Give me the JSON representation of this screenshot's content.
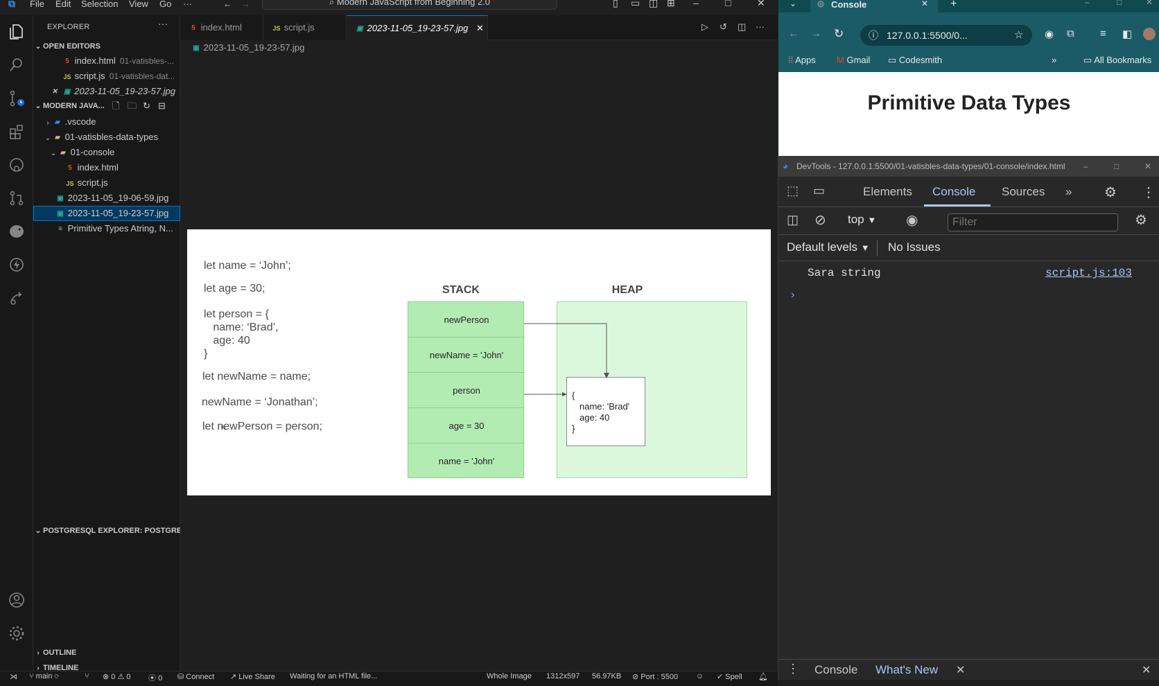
{
  "vscode": {
    "menu": [
      "File",
      "Edit",
      "Selection",
      "View",
      "Go",
      "···"
    ],
    "command_center": "Modern JavaScript from Beginning 2.0",
    "sidebar": {
      "title": "EXPLORER",
      "open_editors_title": "OPEN EDITORS",
      "open_editors": [
        {
          "name": "index.html",
          "desc": "01-vatisbles-...",
          "icon": "html-icon"
        },
        {
          "name": "script.js",
          "desc": "01-vatisbles-dat...",
          "icon": "js-icon"
        },
        {
          "name": "2023-11-05_19-23-57.jpg",
          "desc": "",
          "icon": "image-icon"
        }
      ],
      "workspace_title": "MODERN JAVA...",
      "tree": [
        {
          "name": ".vscode",
          "type": "folder",
          "level": 1
        },
        {
          "name": "01-vatisbles-data-types",
          "type": "folder-open",
          "level": 1
        },
        {
          "name": "01-console",
          "type": "folder-open",
          "level": 2
        },
        {
          "name": "index.html",
          "type": "html",
          "level": 3
        },
        {
          "name": "script.js",
          "type": "js",
          "level": 3
        },
        {
          "name": "2023-11-05_19-06-59.jpg",
          "type": "image",
          "level": 2
        },
        {
          "name": "2023-11-05_19-23-57.jpg",
          "type": "image",
          "level": 2,
          "selected": true
        },
        {
          "name": "Primitive Types Atring, N...",
          "type": "text",
          "level": 2
        }
      ],
      "postgres_title": "POSTGRESQL EXPLORER: POSTGRE...",
      "outline_title": "OUTLINE",
      "timeline_title": "TIMELINE"
    },
    "tabs": [
      {
        "label": "index.html",
        "icon": "html-icon"
      },
      {
        "label": "script.js",
        "icon": "js-icon"
      },
      {
        "label": "2023-11-05_19-23-57.jpg",
        "icon": "image-icon",
        "active": true
      }
    ],
    "breadcrumb": "2023-11-05_19-23-57.jpg",
    "image_content": {
      "code": [
        "let name = ‘John’;",
        "let age = 30;",
        "let person = {",
        "   name: ‘Brad’,",
        "   age: 40",
        "}",
        "let newName = name;",
        "newName = ‘Jonathan’;",
        "let newPerson = person;"
      ],
      "stack_title": "STACK",
      "heap_title": "HEAP",
      "stack_cells": [
        "newPerson",
        "newName = 'John'",
        "person",
        "age = 30",
        "name = 'John'"
      ],
      "heap_object": [
        "{",
        "name: 'Brad'",
        "age: 40",
        "}"
      ]
    },
    "status": {
      "branch": "main",
      "problems": "⊗ 0 ⚠ 0",
      "ports": "0",
      "connect": "Connect",
      "live_share": "Live Share",
      "waiting": "Waiting for an HTML file...",
      "view": "Whole Image",
      "dimensions": "1312x597",
      "size": "56.97KB",
      "port": "Port : 5500",
      "spell": "Spell"
    }
  },
  "chrome": {
    "tab_title": "Console",
    "url": "127.0.0.1:5500/0...",
    "bookmarks": [
      "Apps",
      "Gmail",
      "Codesmith",
      "All Bookmarks"
    ],
    "page_heading": "Primitive Data Types"
  },
  "devtools": {
    "title": "DevTools - 127.0.0.1:5500/01-vatisbles-data-types/01-console/index.html",
    "tabs": [
      "Elements",
      "Console",
      "Sources"
    ],
    "context": "top",
    "filter_placeholder": "Filter",
    "levels": "Default levels",
    "issues": "No Issues",
    "message": "Sara string",
    "source_link": "script.js:103",
    "drawer_tabs": [
      "Console",
      "What's New"
    ]
  },
  "colors": {
    "accent": "#0078d4",
    "stack_fill": "#b3ecb3",
    "heap_fill": "#dcf8dc",
    "chrome_theme": "#1a5b66",
    "devtools_active": "#a8c7fa"
  }
}
